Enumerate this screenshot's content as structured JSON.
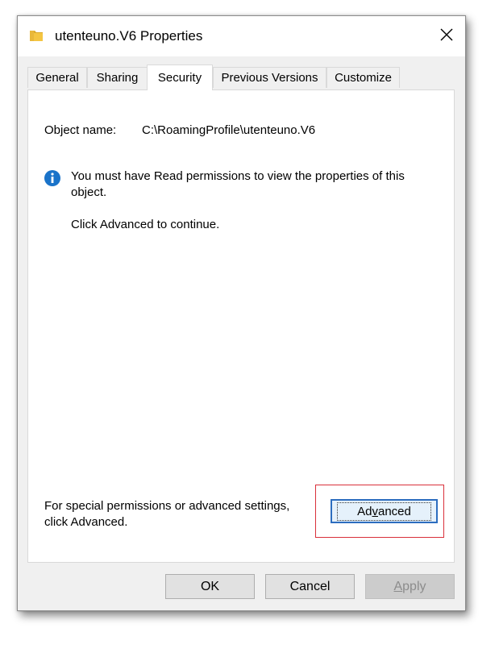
{
  "window": {
    "title": "utenteuno.V6 Properties",
    "close_glyph": "✕",
    "folder_icon": "folder-icon"
  },
  "tabs": [
    {
      "label": "General",
      "active": false
    },
    {
      "label": "Sharing",
      "active": false
    },
    {
      "label": "Security",
      "active": true
    },
    {
      "label": "Previous Versions",
      "active": false
    },
    {
      "label": "Customize",
      "active": false
    }
  ],
  "security": {
    "object_name_label": "Object name:",
    "object_name_value": "C:\\RoamingProfile\\utenteuno.V6",
    "info_message_line1": "You must have Read permissions to view the properties of this",
    "info_message_line2": "object.",
    "continue_text": "Click Advanced to continue.",
    "special_line1": "For special permissions or advanced settings,",
    "special_line2": "click Advanced.",
    "advanced_button": {
      "pre": "Ad",
      "accel": "v",
      "post": "anced"
    }
  },
  "footer": {
    "ok_label": "OK",
    "cancel_label": "Cancel",
    "apply_button": {
      "accel": "A",
      "post": "pply",
      "disabled": true
    }
  },
  "colors": {
    "highlight_border": "#d9303a",
    "info_blue": "#1a73c9",
    "folder_yellow": "#f4c542",
    "focus_blue": "#2c6dbf"
  }
}
